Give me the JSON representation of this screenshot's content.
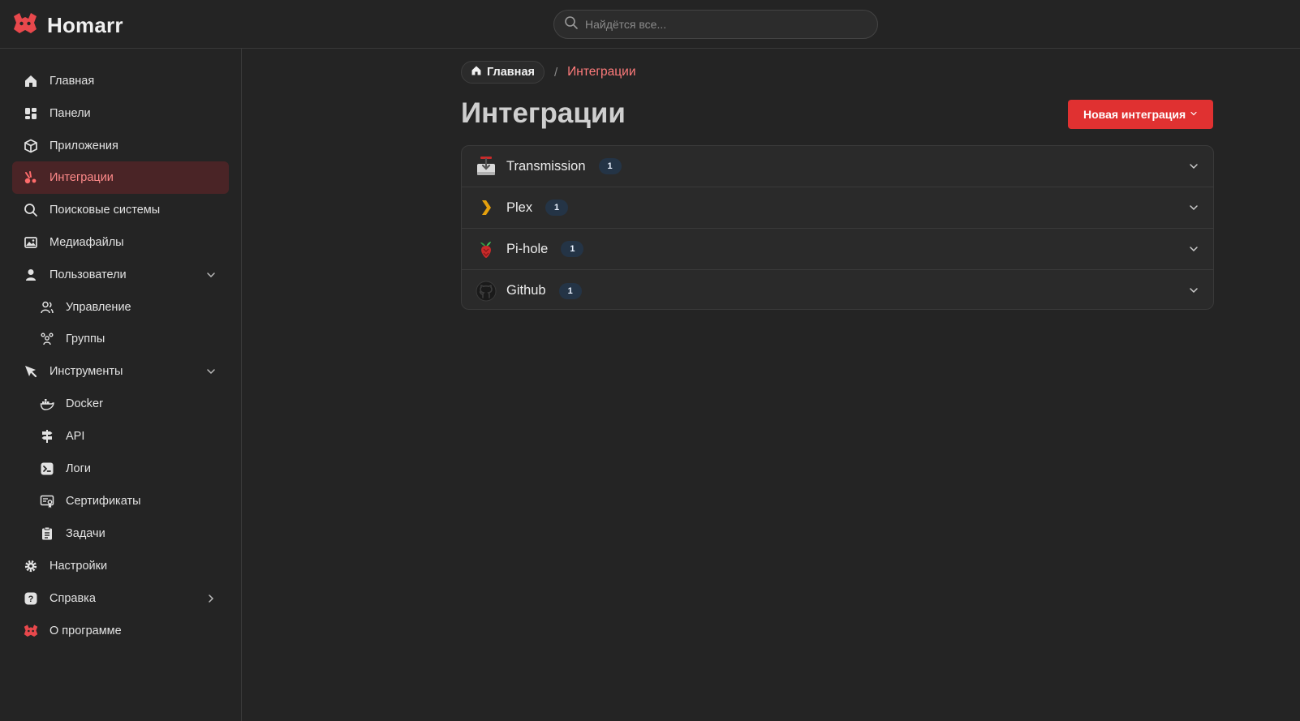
{
  "app": {
    "name": "Homarr"
  },
  "search": {
    "placeholder": "Найдётся все..."
  },
  "sidebar": {
    "items": [
      {
        "label": "Главная"
      },
      {
        "label": "Панели"
      },
      {
        "label": "Приложения"
      },
      {
        "label": "Интеграции",
        "active": true
      },
      {
        "label": "Поисковые системы"
      },
      {
        "label": "Медиафайлы"
      },
      {
        "label": "Пользователи",
        "expanded": true
      },
      {
        "label": "Управление"
      },
      {
        "label": "Группы"
      },
      {
        "label": "Инструменты",
        "expanded": true
      },
      {
        "label": "Docker"
      },
      {
        "label": "API"
      },
      {
        "label": "Логи"
      },
      {
        "label": "Сертификаты"
      },
      {
        "label": "Задачи"
      },
      {
        "label": "Настройки"
      },
      {
        "label": "Справка"
      },
      {
        "label": "О программе"
      }
    ]
  },
  "breadcrumb": {
    "home": "Главная",
    "separator": "/",
    "current": "Интеграции"
  },
  "page": {
    "title": "Интеграции"
  },
  "toolbar": {
    "new_label": "Новая интеграция"
  },
  "integrations": [
    {
      "name": "Transmission",
      "count": "1"
    },
    {
      "name": "Plex",
      "count": "1"
    },
    {
      "name": "Pi-hole",
      "count": "1"
    },
    {
      "name": "Github",
      "count": "1"
    }
  ],
  "colors": {
    "accent": "#e03131",
    "active_bg": "#4a2426",
    "active_text": "#ff8a8a",
    "badge_bg": "#243446"
  }
}
